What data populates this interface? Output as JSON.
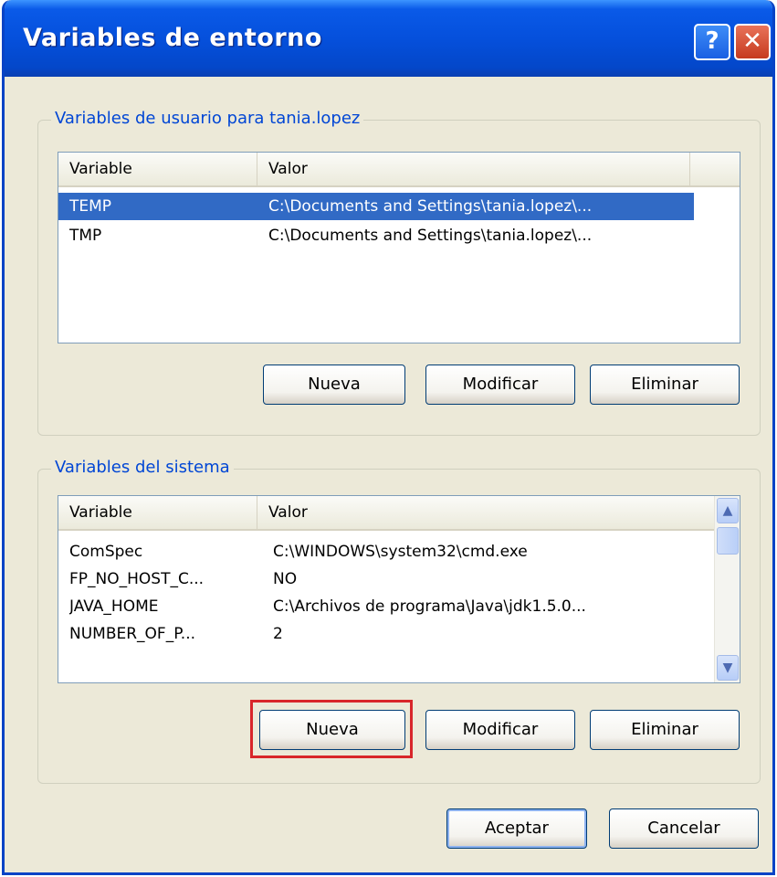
{
  "window": {
    "title": "Variables de entorno",
    "help_label": "?",
    "close_label": "✕"
  },
  "user_vars": {
    "group_label": "Variables de usuario para tania.lopez",
    "columns": [
      "Variable",
      "Valor"
    ],
    "rows": [
      {
        "variable": "TEMP",
        "value": "C:\\Documents and Settings\\tania.lopez\\...",
        "selected": true
      },
      {
        "variable": "TMP",
        "value": "C:\\Documents and Settings\\tania.lopez\\...",
        "selected": false
      }
    ],
    "buttons": {
      "new": "Nueva",
      "edit": "Modificar",
      "delete": "Eliminar"
    }
  },
  "system_vars": {
    "group_label": "Variables del sistema",
    "columns": [
      "Variable",
      "Valor"
    ],
    "rows": [
      {
        "variable": "ComSpec",
        "value": "C:\\WINDOWS\\system32\\cmd.exe"
      },
      {
        "variable": "FP_NO_HOST_C...",
        "value": "NO"
      },
      {
        "variable": "JAVA_HOME",
        "value": "C:\\Archivos de programa\\Java\\jdk1.5.0..."
      },
      {
        "variable": "NUMBER_OF_P...",
        "value": "2"
      }
    ],
    "buttons": {
      "new": "Nueva",
      "edit": "Modificar",
      "delete": "Eliminar"
    },
    "highlighted_button": "new"
  },
  "footer": {
    "ok": "Aceptar",
    "cancel": "Cancelar"
  },
  "colors": {
    "title_bar": "#0550dc",
    "selection": "#316ac5",
    "group_label": "#0046d5",
    "highlight": "#d8262a"
  }
}
